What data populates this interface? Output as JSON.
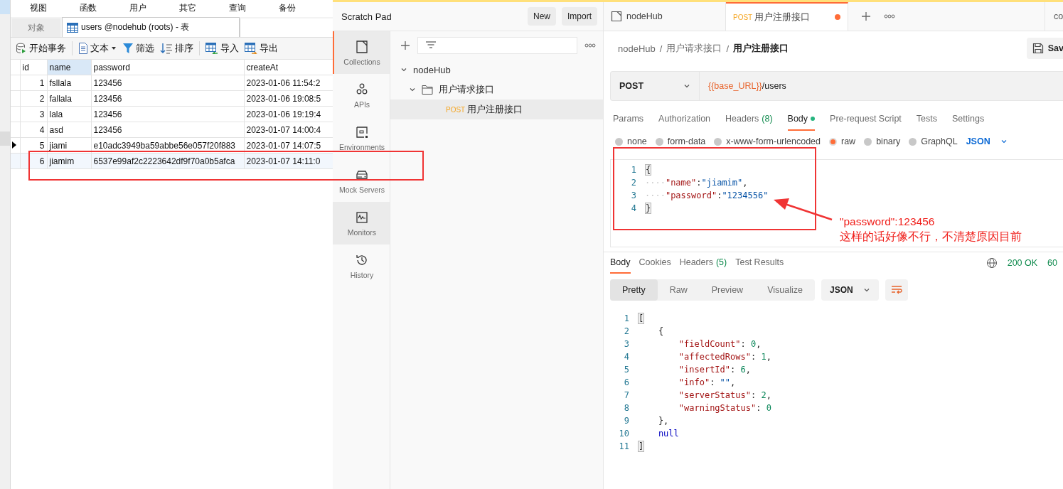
{
  "database_window": {
    "menu": [
      "视图",
      "函数",
      "用户",
      "其它",
      "查询",
      "备份"
    ],
    "tabs": [
      {
        "label": "对象",
        "selected": false
      },
      {
        "label": "users @nodehub (roots) - 表",
        "selected": true
      }
    ],
    "toolbar": [
      {
        "label": "开始事务",
        "kind": "transaction"
      },
      {
        "label": "文本",
        "kind": "text"
      },
      {
        "label": "筛选",
        "kind": "filter"
      },
      {
        "label": "排序",
        "kind": "sort"
      },
      {
        "label": "导入",
        "kind": "import"
      },
      {
        "label": "导出",
        "kind": "export"
      }
    ],
    "table": {
      "columns": [
        {
          "label": "id",
          "selected": false
        },
        {
          "label": "name",
          "selected": true
        },
        {
          "label": "password",
          "selected": false
        },
        {
          "label": "createAt",
          "selected": false
        }
      ],
      "rows": [
        {
          "id": "1",
          "name": "fsllala",
          "password": "123456",
          "createAt": "2023-01-06 11:54:2",
          "current": false,
          "selected": false
        },
        {
          "id": "2",
          "name": "fallala",
          "password": "123456",
          "createAt": "2023-01-06 19:08:5",
          "current": false,
          "selected": false
        },
        {
          "id": "3",
          "name": "lala",
          "password": "123456",
          "createAt": "2023-01-06 19:19:4",
          "current": false,
          "selected": false
        },
        {
          "id": "4",
          "name": "asd",
          "password": "123456",
          "createAt": "2023-01-07 14:00:4",
          "current": false,
          "selected": false
        },
        {
          "id": "5",
          "name": "jiami",
          "password": "e10adc3949ba59abbe56e057f20f883",
          "createAt": "2023-01-07 14:07:5",
          "current": true,
          "selected": false
        },
        {
          "id": "6",
          "name": "jiamim",
          "password": "6537e99af2c2223642df9f70a0b5afca",
          "createAt": "2023-01-07 14:11:0",
          "current": false,
          "selected": true
        }
      ]
    }
  },
  "api_client": {
    "header": {
      "title": "Scratch Pad",
      "buttons": [
        "New",
        "Import"
      ]
    },
    "sidebar": {
      "items": [
        {
          "label": "Collections",
          "kind": "collections",
          "selected": true,
          "highlighted": false
        },
        {
          "label": "APIs",
          "kind": "apis",
          "selected": false,
          "highlighted": false
        },
        {
          "label": "Environments",
          "kind": "environments",
          "selected": false,
          "highlighted": false
        },
        {
          "label": "Mock Servers",
          "kind": "mock",
          "selected": false,
          "highlighted": false
        },
        {
          "label": "Monitors",
          "kind": "monitors",
          "selected": false,
          "highlighted": true
        },
        {
          "label": "History",
          "kind": "history",
          "selected": false,
          "highlighted": false
        }
      ]
    },
    "collections": {
      "tree": [
        {
          "label": "nodeHub",
          "kind": "collection",
          "expanded": true,
          "children": [
            {
              "label": "用户请求接口",
              "kind": "folder",
              "expanded": true,
              "children": [
                {
                  "label": "用户注册接口",
                  "kind": "request",
                  "method": "POST",
                  "selected": true
                }
              ]
            }
          ]
        }
      ]
    },
    "tabs": [
      {
        "label": "nodeHub",
        "kind": "collection",
        "selected": false,
        "unsaved": false
      },
      {
        "label": "用户注册接口",
        "kind": "request",
        "method": "POST",
        "selected": true,
        "unsaved": true
      }
    ],
    "overflow_tab": "co",
    "breadcrumb": [
      {
        "label": "nodeHub",
        "kind": "link"
      },
      {
        "label": "/",
        "kind": "separator"
      },
      {
        "label": "用户请求接口",
        "kind": "link"
      },
      {
        "label": "/",
        "kind": "separator"
      },
      {
        "label": "用户注册接口",
        "kind": "current"
      }
    ],
    "save_button": "Sav",
    "request": {
      "method": "POST",
      "url_variable": "{{base_URL}}",
      "url_path": "/users"
    },
    "request_tabs": [
      {
        "label": "Params",
        "selected": false
      },
      {
        "label": "Authorization",
        "selected": false
      },
      {
        "label": "Headers",
        "count": "(8)",
        "selected": false
      },
      {
        "label": "Body",
        "selected": true,
        "indicator": true
      },
      {
        "label": "Pre-request Script",
        "selected": false
      },
      {
        "label": "Tests",
        "selected": false
      },
      {
        "label": "Settings",
        "selected": false
      }
    ],
    "body_types": [
      {
        "label": "none",
        "selected": false
      },
      {
        "label": "form-data",
        "selected": false
      },
      {
        "label": "x-www-form-urlencoded",
        "selected": false
      },
      {
        "label": "raw",
        "selected": true
      },
      {
        "label": "binary",
        "selected": false
      },
      {
        "label": "GraphQL",
        "selected": false
      }
    ],
    "body_format": "JSON",
    "request_body": [
      {
        "number": "1",
        "tokens": [
          {
            "kind": "bracket",
            "text": "{"
          }
        ]
      },
      {
        "number": "2",
        "tokens": [
          {
            "kind": "space",
            "text": "····"
          },
          {
            "kind": "key",
            "text": "\"name\""
          },
          {
            "kind": "punct",
            "text": ":"
          },
          {
            "kind": "string",
            "text": "\"jiamim\""
          },
          {
            "kind": "punct",
            "text": ","
          }
        ]
      },
      {
        "number": "3",
        "tokens": [
          {
            "kind": "space",
            "text": "····"
          },
          {
            "kind": "key",
            "text": "\"password\""
          },
          {
            "kind": "punct",
            "text": ":"
          },
          {
            "kind": "string",
            "text": "\"1234556\""
          }
        ]
      },
      {
        "number": "4",
        "tokens": [
          {
            "kind": "bracket",
            "text": "}"
          }
        ]
      }
    ],
    "response_tabs": [
      {
        "label": "Body",
        "selected": true
      },
      {
        "label": "Cookies",
        "selected": false
      },
      {
        "label": "Headers",
        "count": "(5)",
        "selected": false
      },
      {
        "label": "Test Results",
        "selected": false
      }
    ],
    "status": "200 OK",
    "time": "60",
    "response_views": [
      {
        "label": "Pretty",
        "selected": true
      },
      {
        "label": "Raw",
        "selected": false
      },
      {
        "label": "Preview",
        "selected": false
      },
      {
        "label": "Visualize",
        "selected": false
      }
    ],
    "response_format": "JSON",
    "response_body": [
      {
        "number": "1",
        "tokens": [
          {
            "kind": "bracket",
            "text": "["
          }
        ]
      },
      {
        "number": "2",
        "tokens": [
          {
            "kind": "punct",
            "text": "    {"
          }
        ]
      },
      {
        "number": "3",
        "tokens": [
          {
            "kind": "key",
            "text": "        \"fieldCount\""
          },
          {
            "kind": "punct",
            "text": ": "
          },
          {
            "kind": "number",
            "text": "0"
          },
          {
            "kind": "punct",
            "text": ","
          }
        ]
      },
      {
        "number": "4",
        "tokens": [
          {
            "kind": "key",
            "text": "        \"affectedRows\""
          },
          {
            "kind": "punct",
            "text": ": "
          },
          {
            "kind": "number",
            "text": "1"
          },
          {
            "kind": "punct",
            "text": ","
          }
        ]
      },
      {
        "number": "5",
        "tokens": [
          {
            "kind": "key",
            "text": "        \"insertId\""
          },
          {
            "kind": "punct",
            "text": ": "
          },
          {
            "kind": "number",
            "text": "6"
          },
          {
            "kind": "punct",
            "text": ","
          }
        ]
      },
      {
        "number": "6",
        "tokens": [
          {
            "kind": "key",
            "text": "        \"info\""
          },
          {
            "kind": "punct",
            "text": ": "
          },
          {
            "kind": "string",
            "text": "\"\""
          },
          {
            "kind": "punct",
            "text": ","
          }
        ]
      },
      {
        "number": "7",
        "tokens": [
          {
            "kind": "key",
            "text": "        \"serverStatus\""
          },
          {
            "kind": "punct",
            "text": ": "
          },
          {
            "kind": "number",
            "text": "2"
          },
          {
            "kind": "punct",
            "text": ","
          }
        ]
      },
      {
        "number": "8",
        "tokens": [
          {
            "kind": "key",
            "text": "        \"warningStatus\""
          },
          {
            "kind": "punct",
            "text": ": "
          },
          {
            "kind": "number",
            "text": "0"
          }
        ]
      },
      {
        "number": "9",
        "tokens": [
          {
            "kind": "punct",
            "text": "    },"
          }
        ]
      },
      {
        "number": "10",
        "tokens": [
          {
            "kind": "keyword",
            "text": "    null"
          }
        ]
      },
      {
        "number": "11",
        "tokens": [
          {
            "kind": "bracket",
            "text": "]"
          }
        ]
      }
    ]
  },
  "annotation": {
    "lines": [
      "\"password\":123456",
      "这样的话好像不行，不清楚原因目前"
    ]
  }
}
